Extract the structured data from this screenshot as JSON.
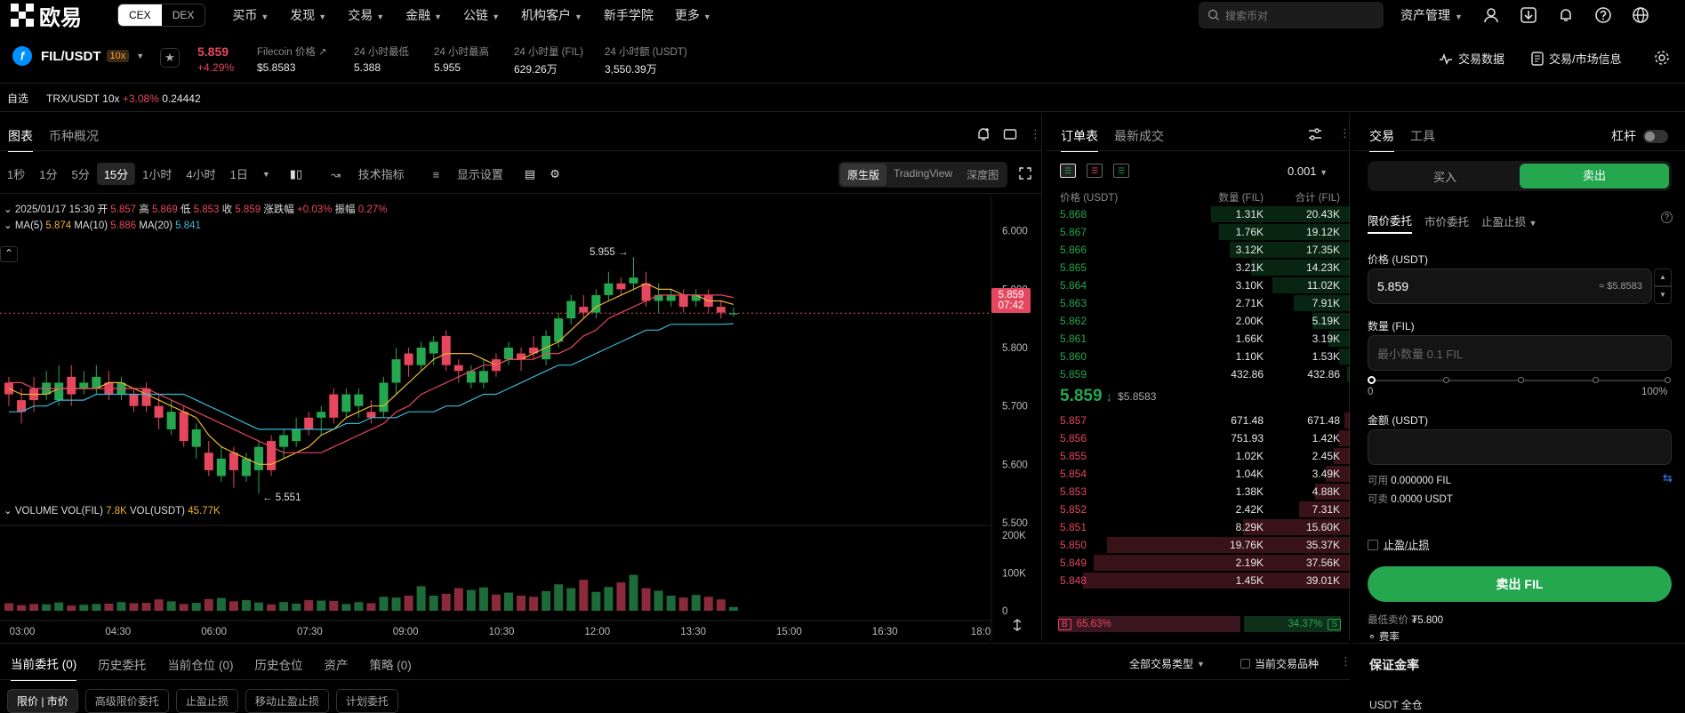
{
  "nav": {
    "logo_text": "欧易",
    "mode_cex": "CEX",
    "mode_dex": "DEX",
    "items": [
      "买币",
      "发现",
      "交易",
      "金融",
      "公链",
      "机构客户",
      "新手学院",
      "更多"
    ],
    "search_placeholder": "搜索币对",
    "asset_mgmt": "资产管理"
  },
  "ticker": {
    "symbol": "FIL/USDT",
    "leverage": "10x",
    "last_price": "5.859",
    "change_pct": "+4.29%",
    "stats": [
      {
        "label": "Filecoin 价格",
        "value": "$5.8583"
      },
      {
        "label": "24 小时最低",
        "value": "5.388"
      },
      {
        "label": "24 小时最高",
        "value": "5.955"
      },
      {
        "label": "24 小时量 (FIL)",
        "value": "629.26万"
      },
      {
        "label": "24 小时额 (USDT)",
        "value": "3,550.39万"
      }
    ],
    "trade_data": "交易数据",
    "market_info": "交易/市场信息"
  },
  "favorites": {
    "label": "自选",
    "item_symbol": "TRX/USDT",
    "item_lev": "10x",
    "item_change": "+3.08%",
    "item_price": "0.24442"
  },
  "chart_tabs": {
    "chart": "图表",
    "overview": "币种概况"
  },
  "timeframes": [
    "1秒",
    "1分",
    "5分",
    "15分",
    "1小时",
    "4小时",
    "1日"
  ],
  "active_timeframe": "15分",
  "toolbar": {
    "indicators": "技术指标",
    "display": "显示设置"
  },
  "views": [
    "原生版",
    "TradingView",
    "深度图"
  ],
  "active_view": "原生版",
  "ohlc": {
    "datetime": "2025/01/17 15:30",
    "open_l": "开",
    "open": "5.857",
    "high_l": "高",
    "high": "5.869",
    "low_l": "低",
    "low": "5.853",
    "close_l": "收",
    "close": "5.859",
    "chg_l": "涨跌幅",
    "chg": "+0.03%",
    "amp_l": "振幅",
    "amp": "0.27%"
  },
  "ma": {
    "ma5_l": "MA(5)",
    "ma5": "5.874",
    "ma10_l": "MA(10)",
    "ma10": "5.886",
    "ma20_l": "MA(20)",
    "ma20": "5.841"
  },
  "volume_legend": {
    "title": "VOLUME",
    "fil_l": "VOL(FIL)",
    "fil": "7.8K",
    "usdt_l": "VOL(USDT)",
    "usdt": "45.77K"
  },
  "price_label": {
    "price": "5.859",
    "countdown": "07:42"
  },
  "annotations": {
    "high": "5.955",
    "low": "5.551"
  },
  "chart_data": {
    "type": "candlestick",
    "y_ticks": [
      "6.000",
      "5.900",
      "5.800",
      "5.700",
      "5.600",
      "5.500"
    ],
    "ylim": [
      5.5,
      6.03
    ],
    "vol_ticks": [
      "200K",
      "100K",
      "0"
    ],
    "x_ticks": [
      "03:00",
      "04:30",
      "06:00",
      "07:30",
      "09:00",
      "10:30",
      "12:00",
      "13:30",
      "15:00",
      "16:30",
      "18:0"
    ],
    "candles": [
      [
        5.74,
        5.72,
        5.75,
        5.7
      ],
      [
        5.71,
        5.69,
        5.73,
        5.67
      ],
      [
        5.73,
        5.71,
        5.75,
        5.69
      ],
      [
        5.72,
        5.74,
        5.76,
        5.71
      ],
      [
        5.71,
        5.74,
        5.77,
        5.7
      ],
      [
        5.75,
        5.72,
        5.77,
        5.7
      ],
      [
        5.73,
        5.74,
        5.76,
        5.72
      ],
      [
        5.73,
        5.75,
        5.77,
        5.72
      ],
      [
        5.74,
        5.72,
        5.76,
        5.71
      ],
      [
        5.72,
        5.74,
        5.75,
        5.71
      ],
      [
        5.72,
        5.7,
        5.73,
        5.69
      ],
      [
        5.73,
        5.7,
        5.74,
        5.69
      ],
      [
        5.7,
        5.68,
        5.72,
        5.66
      ],
      [
        5.66,
        5.69,
        5.71,
        5.65
      ],
      [
        5.69,
        5.64,
        5.7,
        5.63
      ],
      [
        5.63,
        5.66,
        5.67,
        5.61
      ],
      [
        5.62,
        5.59,
        5.64,
        5.58
      ],
      [
        5.58,
        5.61,
        5.63,
        5.57
      ],
      [
        5.62,
        5.59,
        5.63,
        5.56
      ],
      [
        5.58,
        5.61,
        5.62,
        5.57
      ],
      [
        5.59,
        5.63,
        5.64,
        5.55
      ],
      [
        5.64,
        5.59,
        5.65,
        5.58
      ],
      [
        5.63,
        5.65,
        5.66,
        5.61
      ],
      [
        5.64,
        5.66,
        5.68,
        5.63
      ],
      [
        5.68,
        5.66,
        5.69,
        5.65
      ],
      [
        5.68,
        5.69,
        5.7,
        5.65
      ],
      [
        5.72,
        5.68,
        5.73,
        5.67
      ],
      [
        5.69,
        5.72,
        5.73,
        5.68
      ],
      [
        5.7,
        5.72,
        5.73,
        5.68
      ],
      [
        5.69,
        5.68,
        5.71,
        5.67
      ],
      [
        5.69,
        5.74,
        5.75,
        5.68
      ],
      [
        5.74,
        5.78,
        5.8,
        5.72
      ],
      [
        5.79,
        5.77,
        5.8,
        5.75
      ],
      [
        5.77,
        5.8,
        5.81,
        5.76
      ],
      [
        5.79,
        5.81,
        5.82,
        5.77
      ],
      [
        5.82,
        5.77,
        5.83,
        5.76
      ],
      [
        5.77,
        5.76,
        5.78,
        5.74
      ],
      [
        5.74,
        5.76,
        5.77,
        5.73
      ],
      [
        5.74,
        5.76,
        5.78,
        5.73
      ],
      [
        5.78,
        5.76,
        5.79,
        5.75
      ],
      [
        5.78,
        5.8,
        5.81,
        5.77
      ],
      [
        5.79,
        5.78,
        5.8,
        5.76
      ],
      [
        5.8,
        5.79,
        5.82,
        5.78
      ],
      [
        5.78,
        5.82,
        5.83,
        5.77
      ],
      [
        5.81,
        5.85,
        5.86,
        5.8
      ],
      [
        5.85,
        5.88,
        5.89,
        5.84
      ],
      [
        5.87,
        5.86,
        5.89,
        5.85
      ],
      [
        5.86,
        5.89,
        5.9,
        5.85
      ],
      [
        5.89,
        5.91,
        5.93,
        5.88
      ],
      [
        5.91,
        5.9,
        5.92,
        5.89
      ],
      [
        5.91,
        5.92,
        5.955,
        5.9
      ],
      [
        5.91,
        5.88,
        5.93,
        5.87
      ],
      [
        5.88,
        5.89,
        5.91,
        5.86
      ],
      [
        5.88,
        5.89,
        5.9,
        5.87
      ],
      [
        5.89,
        5.87,
        5.9,
        5.86
      ],
      [
        5.88,
        5.89,
        5.9,
        5.87
      ],
      [
        5.89,
        5.87,
        5.9,
        5.86
      ],
      [
        5.87,
        5.86,
        5.88,
        5.85
      ],
      [
        5.857,
        5.859,
        5.869,
        5.853
      ]
    ],
    "volumes": [
      20,
      15,
      18,
      17,
      22,
      14,
      16,
      18,
      19,
      23,
      20,
      21,
      30,
      25,
      18,
      21,
      31,
      34,
      25,
      28,
      22,
      17,
      23,
      19,
      28,
      27,
      26,
      18,
      23,
      20,
      37,
      35,
      40,
      65,
      40,
      45,
      60,
      55,
      62,
      43,
      48,
      40,
      37,
      52,
      70,
      60,
      82,
      50,
      63,
      75,
      95,
      60,
      53,
      40,
      35,
      42,
      37,
      30,
      10
    ],
    "ma5": [
      5.73,
      5.72,
      5.72,
      5.72,
      5.73,
      5.73,
      5.73,
      5.73,
      5.74,
      5.74,
      5.73,
      5.72,
      5.71,
      5.7,
      5.69,
      5.68,
      5.65,
      5.63,
      5.62,
      5.61,
      5.6,
      5.6,
      5.61,
      5.62,
      5.63,
      5.65,
      5.66,
      5.68,
      5.69,
      5.7,
      5.7,
      5.72,
      5.74,
      5.76,
      5.78,
      5.79,
      5.79,
      5.79,
      5.78,
      5.77,
      5.78,
      5.78,
      5.79,
      5.8,
      5.81,
      5.83,
      5.85,
      5.87,
      5.88,
      5.89,
      5.9,
      5.91,
      5.9,
      5.9,
      5.89,
      5.89,
      5.88,
      5.88,
      5.874
    ],
    "ma10": [
      5.74,
      5.74,
      5.73,
      5.73,
      5.73,
      5.73,
      5.73,
      5.73,
      5.73,
      5.73,
      5.73,
      5.73,
      5.72,
      5.71,
      5.7,
      5.69,
      5.68,
      5.67,
      5.66,
      5.65,
      5.64,
      5.63,
      5.62,
      5.62,
      5.62,
      5.62,
      5.63,
      5.64,
      5.65,
      5.66,
      5.67,
      5.69,
      5.7,
      5.72,
      5.73,
      5.74,
      5.75,
      5.76,
      5.77,
      5.77,
      5.78,
      5.78,
      5.78,
      5.79,
      5.79,
      5.8,
      5.82,
      5.83,
      5.85,
      5.86,
      5.87,
      5.88,
      5.89,
      5.89,
      5.89,
      5.89,
      5.89,
      5.89,
      5.886
    ],
    "ma20": [
      5.69,
      5.69,
      5.7,
      5.7,
      5.71,
      5.71,
      5.71,
      5.72,
      5.72,
      5.72,
      5.72,
      5.72,
      5.72,
      5.72,
      5.72,
      5.71,
      5.7,
      5.69,
      5.68,
      5.67,
      5.66,
      5.66,
      5.66,
      5.66,
      5.66,
      5.66,
      5.66,
      5.67,
      5.67,
      5.68,
      5.68,
      5.68,
      5.69,
      5.69,
      5.69,
      5.7,
      5.7,
      5.71,
      5.72,
      5.72,
      5.73,
      5.74,
      5.75,
      5.76,
      5.77,
      5.77,
      5.78,
      5.79,
      5.8,
      5.81,
      5.82,
      5.83,
      5.83,
      5.84,
      5.84,
      5.84,
      5.84,
      5.84,
      5.841
    ]
  },
  "orderbook": {
    "tab_book": "订单表",
    "tab_trades": "最新成交",
    "tick": "0.001",
    "hdr_price": "价格 (USDT)",
    "hdr_qty": "数量 (FIL)",
    "hdr_total": "合计 (FIL)",
    "asks": [
      {
        "p": "5.868",
        "q": "1.31K",
        "t": "20.43K",
        "w": 0.52
      },
      {
        "p": "5.867",
        "q": "1.76K",
        "t": "19.12K",
        "w": 0.49
      },
      {
        "p": "5.866",
        "q": "3.12K",
        "t": "17.35K",
        "w": 0.45
      },
      {
        "p": "5.865",
        "q": "3.21K",
        "t": "14.23K",
        "w": 0.37
      },
      {
        "p": "5.864",
        "q": "3.10K",
        "t": "11.02K",
        "w": 0.29
      },
      {
        "p": "5.863",
        "q": "2.71K",
        "t": "7.91K",
        "w": 0.21
      },
      {
        "p": "5.862",
        "q": "2.00K",
        "t": "5.19K",
        "w": 0.14
      },
      {
        "p": "5.861",
        "q": "1.66K",
        "t": "3.19K",
        "w": 0.08
      },
      {
        "p": "5.860",
        "q": "1.10K",
        "t": "1.53K",
        "w": 0.04
      },
      {
        "p": "5.859",
        "q": "432.86",
        "t": "432.86",
        "w": 0.01
      }
    ],
    "mid_price": "5.859",
    "mid_usd": "$5.8583",
    "bids": [
      {
        "p": "5.857",
        "q": "671.48",
        "t": "671.48",
        "w": 0.02
      },
      {
        "p": "5.856",
        "q": "751.93",
        "t": "1.42K",
        "w": 0.04
      },
      {
        "p": "5.855",
        "q": "1.02K",
        "t": "2.45K",
        "w": 0.06
      },
      {
        "p": "5.854",
        "q": "1.04K",
        "t": "3.49K",
        "w": 0.09
      },
      {
        "p": "5.853",
        "q": "1.38K",
        "t": "4.88K",
        "w": 0.13
      },
      {
        "p": "5.852",
        "q": "2.42K",
        "t": "7.31K",
        "w": 0.19
      },
      {
        "p": "5.851",
        "q": "8.29K",
        "t": "15.60K",
        "w": 0.4
      },
      {
        "p": "5.850",
        "q": "19.76K",
        "t": "35.37K",
        "w": 0.91
      },
      {
        "p": "5.849",
        "q": "2.19K",
        "t": "37.56K",
        "w": 0.96
      },
      {
        "p": "5.848",
        "q": "1.45K",
        "t": "39.01K",
        "w": 1.0
      }
    ],
    "ratio_b_l": "B",
    "ratio_b": "65.63%",
    "ratio_s": "34.37%",
    "ratio_s_l": "S",
    "buy_ratio": 0.6563
  },
  "trade": {
    "tab_trade": "交易",
    "tab_tools": "工具",
    "leverage": "杠杆",
    "buy": "买入",
    "sell": "卖出",
    "order_types": [
      "限价委托",
      "市价委托",
      "止盈止损"
    ],
    "price_l": "价格 (USDT)",
    "price_v": "5.859",
    "price_usd": "≈ $5.8583",
    "qty_l": "数量 (FIL)",
    "qty_ph": "最小数量 0.1 FIL",
    "slider_min": "0",
    "slider_max": "100%",
    "amount_l": "金额 (USDT)",
    "avail_l": "可用",
    "avail_v": "0.000000 FIL",
    "sellable_l": "可卖",
    "sellable_v": "0.0000 USDT",
    "tpsl": "止盈/止损",
    "sell_btn": "卖出 FIL",
    "min_sell_l": "最低卖价",
    "min_sell_v": "₮5.800",
    "fee": "费率"
  },
  "bottom": {
    "tabs": [
      "当前委托 (0)",
      "历史委托",
      "当前仓位 (0)",
      "历史仓位",
      "资产",
      "策略 (0)"
    ],
    "all_types": "全部交易类型",
    "current_pair": "当前交易品种",
    "sub_tabs": [
      "限价 | 市价",
      "高级限价委托",
      "止盈止损",
      "移动止盈止损",
      "计划委托"
    ],
    "margin": "保证金率",
    "usdt_full": "USDT 全仓"
  },
  "colors": {
    "up": "#25a750",
    "down": "#e5475f",
    "ma5": "#f0b232",
    "ma10": "#e5475f",
    "ma20": "#3ab8d6"
  }
}
